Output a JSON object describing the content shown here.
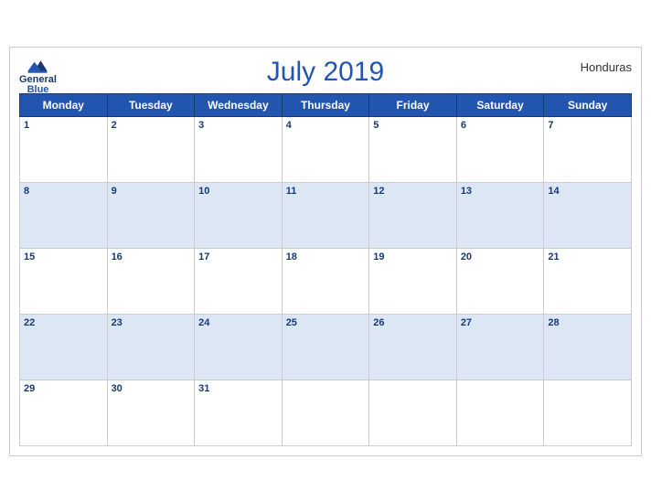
{
  "header": {
    "logo_general": "General",
    "logo_blue": "Blue",
    "title": "July 2019",
    "country": "Honduras"
  },
  "weekdays": [
    "Monday",
    "Tuesday",
    "Wednesday",
    "Thursday",
    "Friday",
    "Saturday",
    "Sunday"
  ],
  "weeks": [
    [
      1,
      2,
      3,
      4,
      5,
      6,
      7
    ],
    [
      8,
      9,
      10,
      11,
      12,
      13,
      14
    ],
    [
      15,
      16,
      17,
      18,
      19,
      20,
      21
    ],
    [
      22,
      23,
      24,
      25,
      26,
      27,
      28
    ],
    [
      29,
      30,
      31,
      null,
      null,
      null,
      null
    ]
  ]
}
